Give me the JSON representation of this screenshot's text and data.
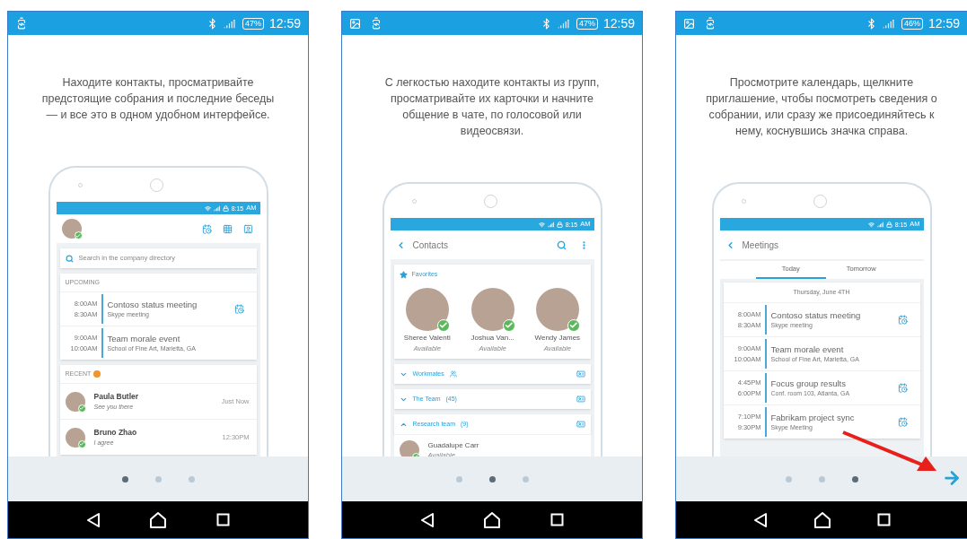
{
  "screens": [
    {
      "status_bar": {
        "notifications": [
          {
            "kind": "battery"
          }
        ],
        "battery": "47%",
        "time": "12:59"
      },
      "description": "Находите контакты, просматривайте предстоящие собрания и последние беседы — и все это в одном удобном интерфейсе.",
      "mockup": {
        "kind": "home",
        "time": "8:15",
        "meridiem": "AM",
        "search_placeholder": "Search in the company directory",
        "upcoming_label": "UPCOMING",
        "meetings": [
          {
            "start": "8:00AM",
            "end": "8:30AM",
            "title": "Contoso status meeting",
            "detail": "Skype meeting",
            "join_icon": true
          },
          {
            "start": "9:00AM",
            "end": "10:00AM",
            "title": "Team morale event",
            "detail": "School of Fine Art, Marietta, GA",
            "join_icon": false
          }
        ],
        "recent_label": "RECENT",
        "recent": [
          {
            "name": "Paula Butler",
            "message": "See you there",
            "time": "Just Now"
          },
          {
            "name": "Bruno Zhao",
            "message": "I agree",
            "time": "12:30PM"
          }
        ]
      },
      "pager": {
        "dots": [
          {
            "selected": true
          },
          {
            "selected": false
          },
          {
            "selected": false
          }
        ],
        "next_button": false
      },
      "annotation_arrow": false
    },
    {
      "status_bar": {
        "notifications": [
          {
            "kind": "image"
          },
          {
            "kind": "battery"
          }
        ],
        "battery": "47%",
        "time": "12:59"
      },
      "description": "С легкостью находите контакты из групп, просматривайте их карточки и начните общение в чате, по голосовой или видеосвязи.",
      "mockup": {
        "kind": "contacts",
        "time": "8:15",
        "meridiem": "AM",
        "title": "Contacts",
        "favorites_label": "Favorites",
        "favorites": [
          {
            "name": "Sheree Valenti",
            "status": "Available"
          },
          {
            "name": "Joshua Van...",
            "status": "Available"
          },
          {
            "name": "Wendy James",
            "status": "Available"
          }
        ],
        "groups": [
          {
            "kind": "people",
            "label": "Workmates",
            "expanded": false
          },
          {
            "kind": "count",
            "label": "The Team",
            "count": "(45)",
            "expanded": false
          },
          {
            "kind": "count",
            "label": "Research team",
            "count": "(9)",
            "expanded": true
          }
        ],
        "members": [
          {
            "name": "Guadalupe Carr",
            "status": "Available"
          }
        ]
      },
      "pager": {
        "dots": [
          {
            "selected": false
          },
          {
            "selected": true
          },
          {
            "selected": false
          }
        ],
        "next_button": false
      },
      "annotation_arrow": false
    },
    {
      "status_bar": {
        "notifications": [
          {
            "kind": "image"
          },
          {
            "kind": "battery"
          }
        ],
        "battery": "46%",
        "time": "12:59"
      },
      "description": "Просмотрите календарь, щелкните приглашение, чтобы посмотреть сведения о собрании, или сразу же присоединяйтесь к нему, коснувшись значка справа.",
      "mockup": {
        "kind": "meetings",
        "time": "8:15",
        "meridiem": "AM",
        "title": "Meetings",
        "tabs": [
          {
            "label": "Today",
            "selected": true
          },
          {
            "label": "Tomorrow",
            "selected": false
          }
        ],
        "date": "Thursday, June 4TH",
        "meetings": [
          {
            "start": "8:00AM",
            "end": "8:30AM",
            "title": "Contoso status meeting",
            "detail": "Skype meeting",
            "join_icon": true
          },
          {
            "start": "9:00AM",
            "end": "10:00AM",
            "title": "Team morale event",
            "detail": "School of Fine Art, Marietta, GA",
            "join_icon": false
          },
          {
            "start": "4:45PM",
            "end": "6:00PM",
            "title": "Focus group results",
            "detail": "Conf. room 103, Atlanta, GA",
            "join_icon": true
          },
          {
            "start": "7:10PM",
            "end": "9:30PM",
            "title": "Fabrikam project sync",
            "detail": "Skype Meeting",
            "join_icon": true
          }
        ]
      },
      "pager": {
        "dots": [
          {
            "selected": false
          },
          {
            "selected": false
          },
          {
            "selected": true
          }
        ],
        "next_button": true
      },
      "annotation_arrow": true
    }
  ]
}
